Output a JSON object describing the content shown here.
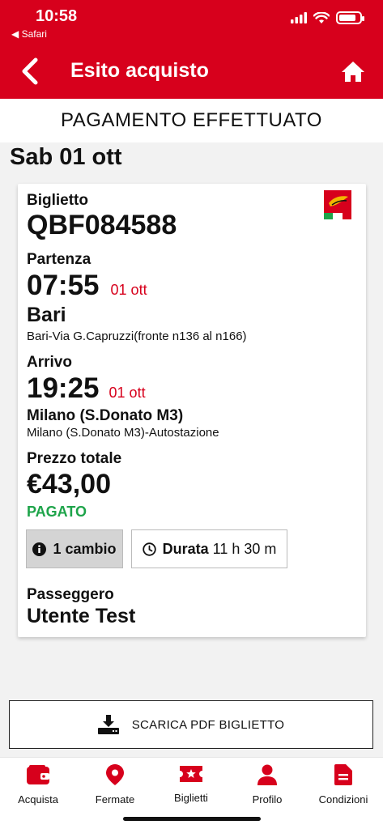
{
  "status_bar": {
    "time": "10:58",
    "back_label": "◀ Safari"
  },
  "header": {
    "title": "Esito acquisto"
  },
  "banner": {
    "text": "PAGAMENTO EFFETTUATO"
  },
  "date": "Sab 01 ott",
  "ticket": {
    "code_label": "Biglietto",
    "code": "QBF084588",
    "departure": {
      "label": "Partenza",
      "time": "07:55",
      "date": "01 ott",
      "city": "Bari",
      "address": "Bari-Via G.Capruzzi(fronte n136 al n166)"
    },
    "arrival": {
      "label": "Arrivo",
      "time": "19:25",
      "date": "01 ott",
      "city": "Milano (S.Donato M3)",
      "address": "Milano (S.Donato M3)-Autostazione"
    },
    "price": {
      "label": "Prezzo totale",
      "amount": "€43,00",
      "status": "PAGATO"
    },
    "changes": "1 cambio",
    "duration": {
      "label": "Durata",
      "value": "11 h 30 m"
    },
    "passenger": {
      "label": "Passeggero",
      "name": "Utente Test"
    }
  },
  "download_button": "SCARICA PDF BIGLIETTO",
  "tabs": [
    {
      "label": "Acquista",
      "icon": "wallet-icon"
    },
    {
      "label": "Fermate",
      "icon": "map-pin-icon"
    },
    {
      "label": "Biglietti",
      "icon": "ticket-icon"
    },
    {
      "label": "Profilo",
      "icon": "user-icon"
    },
    {
      "label": "Condizioni",
      "icon": "document-icon"
    }
  ],
  "colors": {
    "brand": "#d7001c",
    "paid": "#1ea44a",
    "background": "#f2f2f2"
  }
}
